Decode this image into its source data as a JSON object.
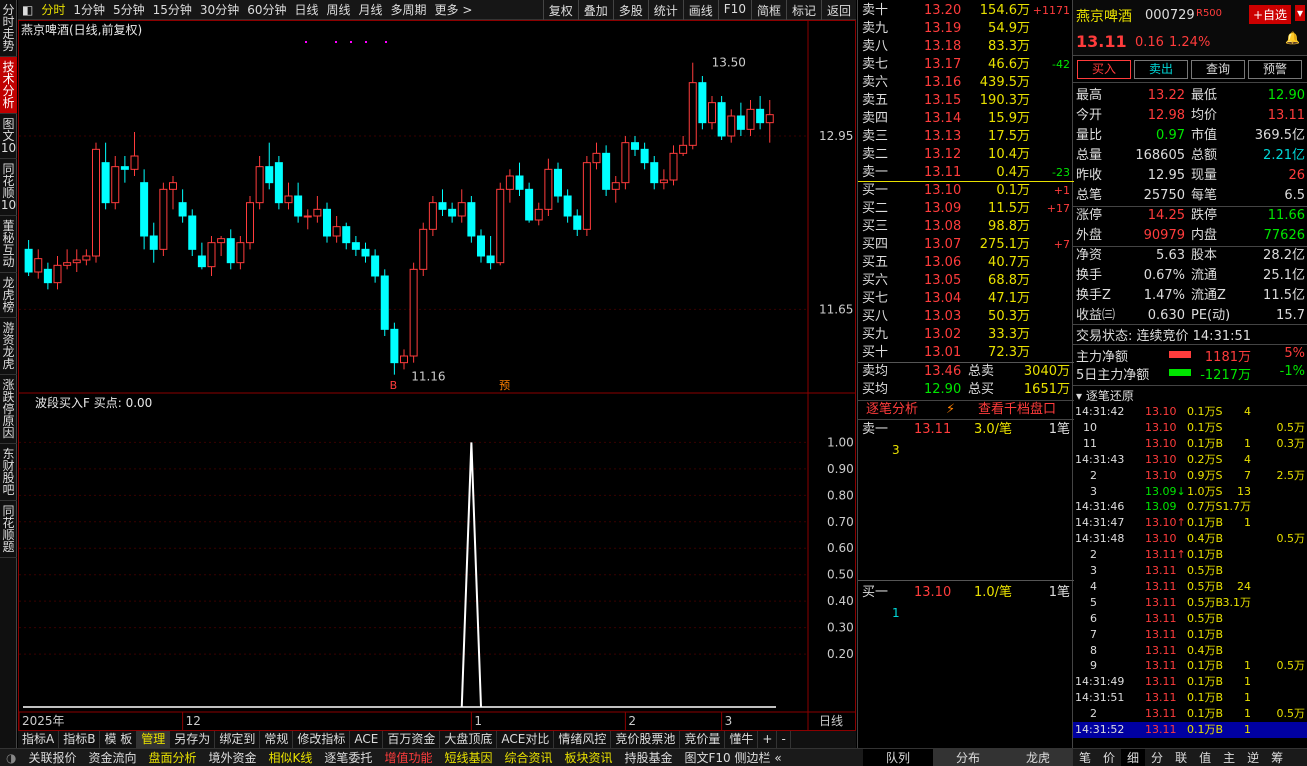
{
  "left_tabs": [
    "分时走势",
    "技术分析",
    "图文10",
    "同花顺10",
    "董秘互动",
    "龙虎榜",
    "游资龙虎",
    "涨跌停原因",
    "东财股吧",
    "同花顺题"
  ],
  "top_menu": {
    "periods": [
      "分时",
      "1分钟",
      "5分钟",
      "15分钟",
      "30分钟",
      "60分钟",
      "日线",
      "周线",
      "月线",
      "多周期",
      "更多 >"
    ],
    "tools": [
      "复权",
      "叠加",
      "多股",
      "统计",
      "画线",
      "F10",
      "简框",
      "标记",
      "返回"
    ]
  },
  "chart": {
    "title": "燕京啤酒(日线,前复权)",
    "high_label": "13.50",
    "low_label": "11.16",
    "axis_right": [
      "12.95",
      "11.65"
    ],
    "b_marker": "B",
    "yu_marker": "预",
    "x_labels": [
      "2025年",
      "12",
      "1",
      "2",
      "3"
    ],
    "period_label": "日线"
  },
  "indicator": {
    "title": "波段买入F",
    "subtitle": "买点: 0.00",
    "axis": [
      "1.00",
      "0.90",
      "0.80",
      "0.70",
      "0.60",
      "0.50",
      "0.40",
      "0.30",
      "0.20"
    ],
    "x_labels": [
      "2025年",
      "12",
      "1",
      "2",
      "3"
    ]
  },
  "bottom_tabs": [
    "指标A",
    "指标B",
    "模 板",
    "管理",
    "另存为",
    "绑定到",
    "常规",
    "修改指标",
    "ACE",
    "百万资金",
    "大盘顶底",
    "ACE对比",
    "情绪风控",
    "竞价股票池",
    "竞价量",
    "懂牛",
    "+",
    "-"
  ],
  "status": [
    "关联报价",
    "资金流向",
    "盘面分析",
    "境外资金",
    "相似K线",
    "逐笔委托",
    "增值功能",
    "短线基因",
    "综合资讯",
    "板块资讯",
    "持股基金",
    "图文F10 侧边栏 «"
  ],
  "order_book": {
    "sells": [
      [
        "卖十",
        "13.20",
        "154.6万",
        "+1171"
      ],
      [
        "卖九",
        "13.19",
        "54.9万",
        ""
      ],
      [
        "卖八",
        "13.18",
        "83.3万",
        ""
      ],
      [
        "卖七",
        "13.17",
        "46.6万",
        "-42"
      ],
      [
        "卖六",
        "13.16",
        "439.5万",
        ""
      ],
      [
        "卖五",
        "13.15",
        "190.3万",
        ""
      ],
      [
        "卖四",
        "13.14",
        "15.9万",
        ""
      ],
      [
        "卖三",
        "13.13",
        "17.5万",
        ""
      ],
      [
        "卖二",
        "13.12",
        "10.4万",
        ""
      ],
      [
        "卖一",
        "13.11",
        "0.4万",
        "-23"
      ]
    ],
    "buys": [
      [
        "买一",
        "13.10",
        "0.1万",
        "+1"
      ],
      [
        "买二",
        "13.09",
        "11.5万",
        "+17"
      ],
      [
        "买三",
        "13.08",
        "98.8万",
        ""
      ],
      [
        "买四",
        "13.07",
        "275.1万",
        "+7"
      ],
      [
        "买五",
        "13.06",
        "40.7万",
        ""
      ],
      [
        "买六",
        "13.05",
        "68.8万",
        ""
      ],
      [
        "买七",
        "13.04",
        "47.1万",
        ""
      ],
      [
        "买八",
        "13.03",
        "50.3万",
        ""
      ],
      [
        "买九",
        "13.02",
        "33.3万",
        ""
      ],
      [
        "买十",
        "13.01",
        "72.3万",
        ""
      ]
    ],
    "sell_avg": {
      "label": "卖均",
      "price": "13.46",
      "total_label": "总卖",
      "total": "3040万"
    },
    "buy_avg": {
      "label": "买均",
      "price": "12.90",
      "total_label": "总买",
      "total": "1651万"
    },
    "tabs": [
      "逐笔分析",
      "查看千档盘口"
    ],
    "sell1": {
      "label": "卖一",
      "price": "13.11",
      "size": "3.0/笔",
      "count": "1笔",
      "queue": "3"
    },
    "buy1": {
      "label": "买一",
      "price": "13.10",
      "size": "1.0/笔",
      "count": "1笔",
      "queue": "1"
    },
    "bottom_tabs": [
      "队列",
      "分布",
      "龙虎"
    ]
  },
  "quote": {
    "name": "燕京啤酒",
    "code": "000729",
    "tag": "R500",
    "add": "+自选",
    "price": "13.11",
    "change": "0.16",
    "pct": "1.24%",
    "buttons": [
      "买入",
      "卖出",
      "查询",
      "预警"
    ],
    "rows": [
      [
        "最高",
        "13.22",
        "最低",
        "12.90"
      ],
      [
        "今开",
        "12.98",
        "均价",
        "13.11"
      ],
      [
        "量比",
        "0.97",
        "市值",
        "369.5亿"
      ],
      [
        "总量",
        "168605",
        "总额",
        "2.21亿"
      ],
      [
        "昨收",
        "12.95",
        "现量",
        "26"
      ],
      [
        "总笔",
        "25750",
        "每笔",
        "6.5"
      ],
      [
        "涨停",
        "14.25",
        "跌停",
        "11.66"
      ],
      [
        "外盘",
        "90979",
        "内盘",
        "77626"
      ],
      [
        "净资",
        "5.63",
        "股本",
        "28.2亿"
      ],
      [
        "换手",
        "0.67%",
        "流通",
        "25.1亿"
      ],
      [
        "换手Z",
        "1.47%",
        "流通Z",
        "11.5亿"
      ],
      [
        "收益㈢",
        "0.630",
        "PE(动)",
        "15.7"
      ]
    ],
    "trade_state": "交易状态: 连续竞价 14:31:51",
    "main_flow": {
      "label": "主力净额",
      "value": "1181万",
      "pct": "5%"
    },
    "main_flow5": {
      "label": "5日主力净额",
      "value": "-1217万",
      "pct": "-1%"
    },
    "tick_title": "逐笔还原"
  },
  "ticks": [
    [
      "14:31:42",
      "13.10",
      "0.1万S",
      "4",
      ""
    ],
    [
      "10",
      "13.10",
      "0.1万S",
      "",
      "0.5万"
    ],
    [
      "11",
      "13.10",
      "0.1万B",
      "1",
      "0.3万"
    ],
    [
      "14:31:43",
      "13.10",
      "0.2万S",
      "4",
      ""
    ],
    [
      "2",
      "13.10",
      "0.9万S",
      "7",
      "2.5万"
    ],
    [
      "3",
      "13.09↓",
      "1.0万S",
      "13",
      ""
    ],
    [
      "14:31:46",
      "13.09",
      "0.7万S",
      "1.7万",
      ""
    ],
    [
      "14:31:47",
      "13.10↑",
      "0.1万B",
      "1",
      ""
    ],
    [
      "14:31:48",
      "13.10",
      "0.4万B",
      "",
      "0.5万"
    ],
    [
      "2",
      "13.11↑",
      "0.1万B",
      "",
      ""
    ],
    [
      "3",
      "13.11",
      "0.5万B",
      "",
      ""
    ],
    [
      "4",
      "13.11",
      "0.5万B",
      "24",
      ""
    ],
    [
      "5",
      "13.11",
      "0.5万B",
      "3.1万",
      ""
    ],
    [
      "6",
      "13.11",
      "0.5万B",
      "",
      ""
    ],
    [
      "7",
      "13.11",
      "0.1万B",
      "",
      ""
    ],
    [
      "8",
      "13.11",
      "0.4万B",
      "",
      ""
    ],
    [
      "9",
      "13.11",
      "0.1万B",
      "1",
      "0.5万"
    ],
    [
      "14:31:49",
      "13.11",
      "0.1万B",
      "1",
      ""
    ],
    [
      "14:31:51",
      "13.11",
      "0.1万B",
      "1",
      ""
    ],
    [
      "2",
      "13.11",
      "0.1万B",
      "1",
      "0.5万"
    ],
    [
      "14:31:52",
      "13.11",
      "0.1万B",
      "1",
      ""
    ]
  ],
  "tick_tabs": [
    "笔",
    "价",
    "细",
    "分",
    "联",
    "值",
    "主",
    "逆",
    "筹"
  ],
  "candles": [
    [
      18,
      12.1,
      11.93,
      12.17,
      11.9
    ],
    [
      20,
      11.93,
      12.03,
      12.1,
      11.88
    ],
    [
      22,
      11.95,
      11.85,
      12.0,
      11.8
    ],
    [
      24,
      11.85,
      11.98,
      12.05,
      11.8
    ],
    [
      26,
      11.98,
      12.0,
      12.1,
      11.95
    ],
    [
      28,
      12.0,
      12.02,
      12.1,
      11.93
    ],
    [
      30,
      12.02,
      12.05,
      12.1,
      11.98
    ],
    [
      32,
      12.05,
      12.85,
      12.9,
      12.0
    ],
    [
      34,
      12.75,
      12.45,
      12.9,
      12.4
    ],
    [
      36,
      12.45,
      12.72,
      12.8,
      12.4
    ],
    [
      38,
      12.72,
      12.7,
      12.8,
      12.6
    ],
    [
      40,
      12.7,
      12.8,
      12.98,
      12.65
    ],
    [
      42,
      12.6,
      12.2,
      12.7,
      12.1
    ],
    [
      44,
      12.2,
      12.1,
      12.3,
      12.0
    ],
    [
      46,
      12.1,
      12.55,
      12.6,
      12.05
    ],
    [
      48,
      12.55,
      12.6,
      12.65,
      12.4
    ],
    [
      50,
      12.45,
      12.35,
      12.55,
      12.3
    ],
    [
      52,
      12.35,
      12.1,
      12.4,
      12.05
    ],
    [
      54,
      12.05,
      11.97,
      12.15,
      11.95
    ],
    [
      56,
      11.97,
      12.15,
      12.2,
      11.9
    ],
    [
      58,
      12.15,
      12.18,
      12.2,
      12.05
    ],
    [
      60,
      12.18,
      12.0,
      12.25,
      11.95
    ],
    [
      62,
      12.0,
      12.15,
      12.2,
      11.95
    ],
    [
      64,
      12.15,
      12.45,
      12.5,
      12.1
    ],
    [
      66,
      12.45,
      12.72,
      12.8,
      12.4
    ],
    [
      68,
      12.72,
      12.6,
      12.9,
      12.55
    ],
    [
      70,
      12.75,
      12.45,
      12.8,
      12.4
    ],
    [
      72,
      12.45,
      12.5,
      12.6,
      12.4
    ],
    [
      74,
      12.5,
      12.35,
      12.6,
      12.3
    ],
    [
      76,
      12.35,
      12.35,
      12.4,
      12.25
    ],
    [
      78,
      12.35,
      12.4,
      12.5,
      12.3
    ],
    [
      80,
      12.4,
      12.2,
      12.45,
      12.15
    ],
    [
      82,
      12.2,
      12.27,
      12.35,
      12.15
    ],
    [
      84,
      12.27,
      12.15,
      12.3,
      12.1
    ],
    [
      86,
      12.15,
      12.1,
      12.2,
      12.05
    ],
    [
      88,
      12.1,
      12.05,
      12.15,
      12.0
    ],
    [
      90,
      12.05,
      11.9,
      12.1,
      11.85
    ],
    [
      92,
      11.9,
      11.5,
      11.95,
      11.45
    ],
    [
      94,
      11.5,
      11.25,
      11.55,
      11.16
    ],
    [
      96,
      11.25,
      11.3,
      11.35,
      11.2
    ],
    [
      98,
      11.3,
      11.95,
      12.0,
      11.25
    ],
    [
      100,
      11.95,
      12.25,
      12.3,
      11.9
    ],
    [
      102,
      12.25,
      12.45,
      12.5,
      12.2
    ],
    [
      104,
      12.45,
      12.4,
      12.55,
      12.35
    ],
    [
      106,
      12.4,
      12.35,
      12.45,
      12.3
    ],
    [
      108,
      12.35,
      12.45,
      12.55,
      12.3
    ],
    [
      110,
      12.45,
      12.2,
      12.5,
      12.15
    ],
    [
      112,
      12.2,
      12.05,
      12.25,
      12.0
    ],
    [
      114,
      12.05,
      12.0,
      12.2,
      11.95
    ],
    [
      116,
      12.0,
      12.55,
      12.6,
      11.98
    ],
    [
      118,
      12.55,
      12.65,
      12.7,
      12.45
    ],
    [
      120,
      12.65,
      12.55,
      12.75,
      12.5
    ],
    [
      122,
      12.55,
      12.32,
      12.6,
      12.3
    ],
    [
      124,
      12.32,
      12.4,
      12.45,
      12.28
    ],
    [
      126,
      12.4,
      12.7,
      12.78,
      12.35
    ],
    [
      128,
      12.7,
      12.5,
      12.75,
      12.45
    ],
    [
      130,
      12.5,
      12.35,
      12.55,
      12.3
    ],
    [
      132,
      12.35,
      12.25,
      12.4,
      12.2
    ],
    [
      134,
      12.25,
      12.75,
      12.8,
      12.2
    ],
    [
      136,
      12.75,
      12.82,
      12.9,
      12.7
    ],
    [
      138,
      12.82,
      12.55,
      12.88,
      12.5
    ],
    [
      140,
      12.55,
      12.6,
      12.65,
      12.45
    ],
    [
      142,
      12.6,
      12.9,
      12.95,
      12.55
    ],
    [
      144,
      12.9,
      12.85,
      12.95,
      12.8
    ],
    [
      146,
      12.85,
      12.75,
      12.9,
      12.7
    ],
    [
      148,
      12.75,
      12.6,
      12.8,
      12.55
    ],
    [
      150,
      12.6,
      12.62,
      12.7,
      12.55
    ],
    [
      152,
      12.62,
      12.82,
      12.88,
      12.58
    ],
    [
      154,
      12.82,
      12.88,
      12.95,
      12.8
    ],
    [
      156,
      12.88,
      13.35,
      13.5,
      12.85
    ],
    [
      158,
      13.35,
      13.05,
      13.4,
      13.0
    ],
    [
      160,
      13.05,
      13.2,
      13.25,
      13.0
    ],
    [
      162,
      13.2,
      12.95,
      13.25,
      12.92
    ],
    [
      164,
      12.95,
      13.1,
      13.15,
      12.9
    ],
    [
      166,
      13.1,
      13.0,
      13.2,
      12.95
    ],
    [
      168,
      13.0,
      13.15,
      13.22,
      12.95
    ],
    [
      170,
      13.15,
      13.05,
      13.25,
      13.0
    ],
    [
      172,
      13.05,
      13.11,
      13.22,
      12.9
    ]
  ],
  "signal": [
    [
      108,
      0.0
    ],
    [
      109,
      0.5
    ],
    [
      110,
      1.0
    ],
    [
      111,
      0.5
    ],
    [
      112,
      0.0
    ]
  ]
}
